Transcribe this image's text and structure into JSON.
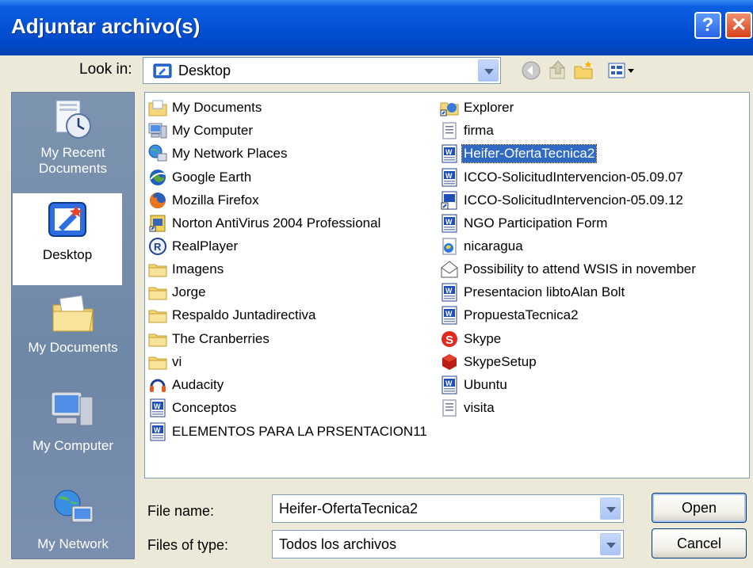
{
  "dialog": {
    "title": "Adjuntar archivo(s)"
  },
  "toolbar": {
    "lookin_label": "Look in:",
    "lookin_value": "Desktop"
  },
  "places": [
    {
      "name": "recent",
      "label": "My Recent Documents"
    },
    {
      "name": "desktop",
      "label": "Desktop",
      "selected": true
    },
    {
      "name": "documents",
      "label": "My Documents"
    },
    {
      "name": "computer",
      "label": "My Computer"
    },
    {
      "name": "network",
      "label": "My Network"
    }
  ],
  "files": [
    {
      "name": "My Documents",
      "icon": "folder-docs-icon"
    },
    {
      "name": "My Computer",
      "icon": "computer-icon"
    },
    {
      "name": "My Network Places",
      "icon": "network-icon"
    },
    {
      "name": "Google Earth",
      "icon": "google-earth-icon"
    },
    {
      "name": "Mozilla Firefox",
      "icon": "firefox-icon"
    },
    {
      "name": "Norton AntiVirus 2004 Professional",
      "icon": "norton-icon"
    },
    {
      "name": "RealPlayer",
      "icon": "realplayer-icon"
    },
    {
      "name": "Imagens",
      "icon": "folder-icon"
    },
    {
      "name": "Jorge",
      "icon": "folder-icon"
    },
    {
      "name": "Respaldo Juntadirectiva",
      "icon": "folder-icon"
    },
    {
      "name": "The Cranberries",
      "icon": "folder-icon"
    },
    {
      "name": "vi",
      "icon": "folder-icon"
    },
    {
      "name": "Audacity",
      "icon": "audacity-icon"
    },
    {
      "name": "Conceptos",
      "icon": "word-doc-icon"
    },
    {
      "name": "ELEMENTOS PARA LA PRSENTACION11",
      "icon": "word-doc-icon"
    },
    {
      "name": "Explorer",
      "icon": "explorer-shortcut-icon"
    },
    {
      "name": "firma",
      "icon": "text-file-icon"
    },
    {
      "name": "Heifer-OfertaTecnica2",
      "icon": "word-doc-icon",
      "selected": true
    },
    {
      "name": "ICCO-SolicitudIntervencion-05.09.07",
      "icon": "word-doc-icon"
    },
    {
      "name": "ICCO-SolicitudIntervencion-05.09.12",
      "icon": "word-shortcut-icon"
    },
    {
      "name": "NGO Participation Form",
      "icon": "word-doc-icon"
    },
    {
      "name": "nicaragua",
      "icon": "media-icon"
    },
    {
      "name": "Possibility to attend WSIS in november",
      "icon": "email-icon"
    },
    {
      "name": "Presentacion libtoAlan Bolt",
      "icon": "word-doc-icon"
    },
    {
      "name": "PropuestaTecnica2",
      "icon": "word-doc-icon"
    },
    {
      "name": "Skype",
      "icon": "skype-icon"
    },
    {
      "name": "SkypeSetup",
      "icon": "skype-setup-icon"
    },
    {
      "name": "Ubuntu",
      "icon": "word-doc-icon"
    },
    {
      "name": "visita",
      "icon": "text-file-icon"
    }
  ],
  "bottom": {
    "filename_label": "File name:",
    "filename_value": "Heifer-OfertaTecnica2",
    "filetype_label": "Files of type:",
    "filetype_value": "Todos los archivos",
    "open_label": "Open",
    "cancel_label": "Cancel"
  },
  "colors": {
    "title_blue": "#0552d6",
    "selection": "#316ac5",
    "places_bar": "#7d94b0",
    "dialog_bg": "#ece9d8"
  }
}
